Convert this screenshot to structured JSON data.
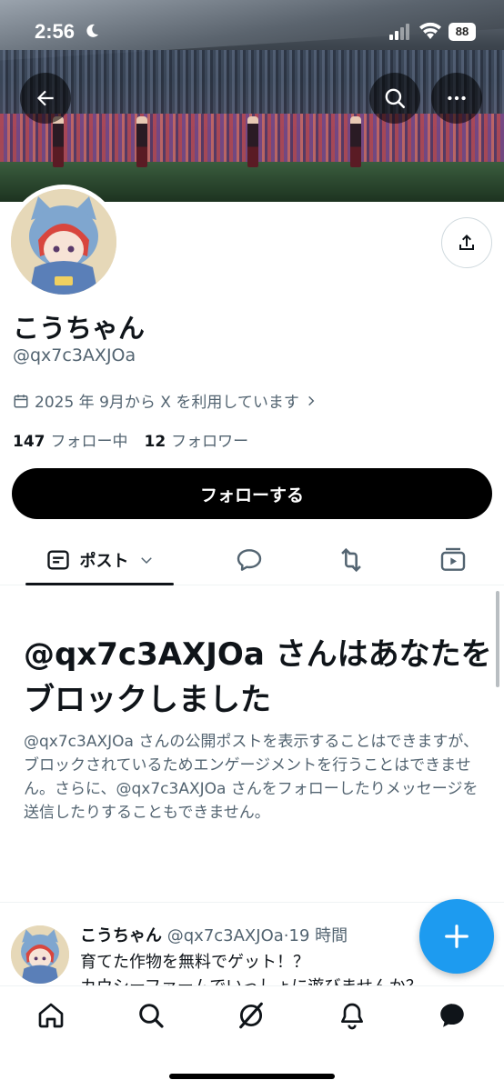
{
  "status_bar": {
    "time": "2:56",
    "battery": "88"
  },
  "profile": {
    "name": "こうちゃん",
    "handle": "@qx7c3AXJOa",
    "joined": "2025 年 9月から X を利用しています",
    "following_count": "147",
    "following_label": "フォロー中",
    "followers_count": "12",
    "followers_label": "フォロワー",
    "follow_button": "フォローする"
  },
  "tabs": {
    "posts": "ポスト"
  },
  "block_notice": {
    "title": "@qx7c3AXJOa さんはあなたをブロックしました",
    "body": "@qx7c3AXJOa さんの公開ポストを表示することはできますが、ブロックされているためエンゲージメントを行うことはできません。さらに、@qx7c3AXJOa さんをフォローしたりメッセージを送信したりすることもできません。"
  },
  "post": {
    "author": "こうちゃん",
    "handle": "@qx7c3AXJOa",
    "time": "19 時間",
    "line1": "育てた作物を無料でゲット！？",
    "line2": "カウシーファームでいっしょに遊びませんか？"
  },
  "colors": {
    "accent": "#1d9bf0",
    "text": "#0f1419",
    "secondary": "#536471"
  },
  "icons": [
    "back-arrow-icon",
    "search-icon",
    "more-icon",
    "share-icon",
    "calendar-icon",
    "chevron-right-icon",
    "posts-icon",
    "chevron-down-icon",
    "reply-icon",
    "repost-icon",
    "media-icon",
    "plus-icon",
    "home-icon",
    "explore-icon",
    "grok-icon",
    "notifications-icon",
    "messages-icon"
  ]
}
